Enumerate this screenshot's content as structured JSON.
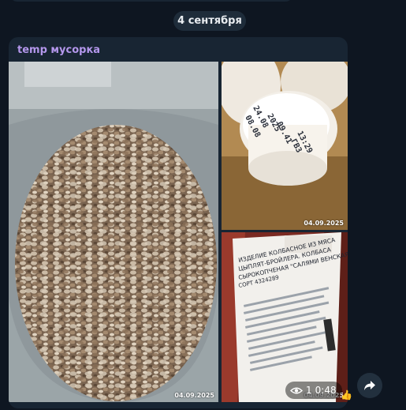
{
  "date_pill": "4 сентября",
  "message": {
    "sender": "temp мусорка",
    "sender_color": "#b497ec",
    "photos": [
      {
        "name": "buckwheat-photo",
        "date_stamp": "04.09.2025"
      },
      {
        "name": "bottle-cap-photo",
        "date_stamp": "04.09.2025",
        "text_lines": [
          "24.08",
          "08.08",
          "2025",
          "09.41",
          "13:29",
          "ГВ3"
        ]
      },
      {
        "name": "sausage-label-photo",
        "date_stamp": "04.09.2025",
        "text_lines": [
          "ИЗДЕЛИЕ КОЛБАСНОЕ ИЗ МЯСА",
          "ЦЫПЛЯТ-БРОЙЛЕРА. КОЛБАСА",
          "СЫРОКОПЧЕНАЯ \"САЛЯМИ ВЕНСКАЯ\" ПЕРВЫ",
          "СОРТ 4324289"
        ]
      }
    ],
    "views": "1",
    "time": "0:48",
    "reaction": "👍"
  },
  "icons": {
    "eye": "eye-icon",
    "share": "forward-arrow-icon",
    "reaction": "thumbs-up-icon"
  },
  "colors": {
    "background": "#0e1621",
    "bubble": "#182533",
    "date_pill": "#1e2c3a"
  }
}
